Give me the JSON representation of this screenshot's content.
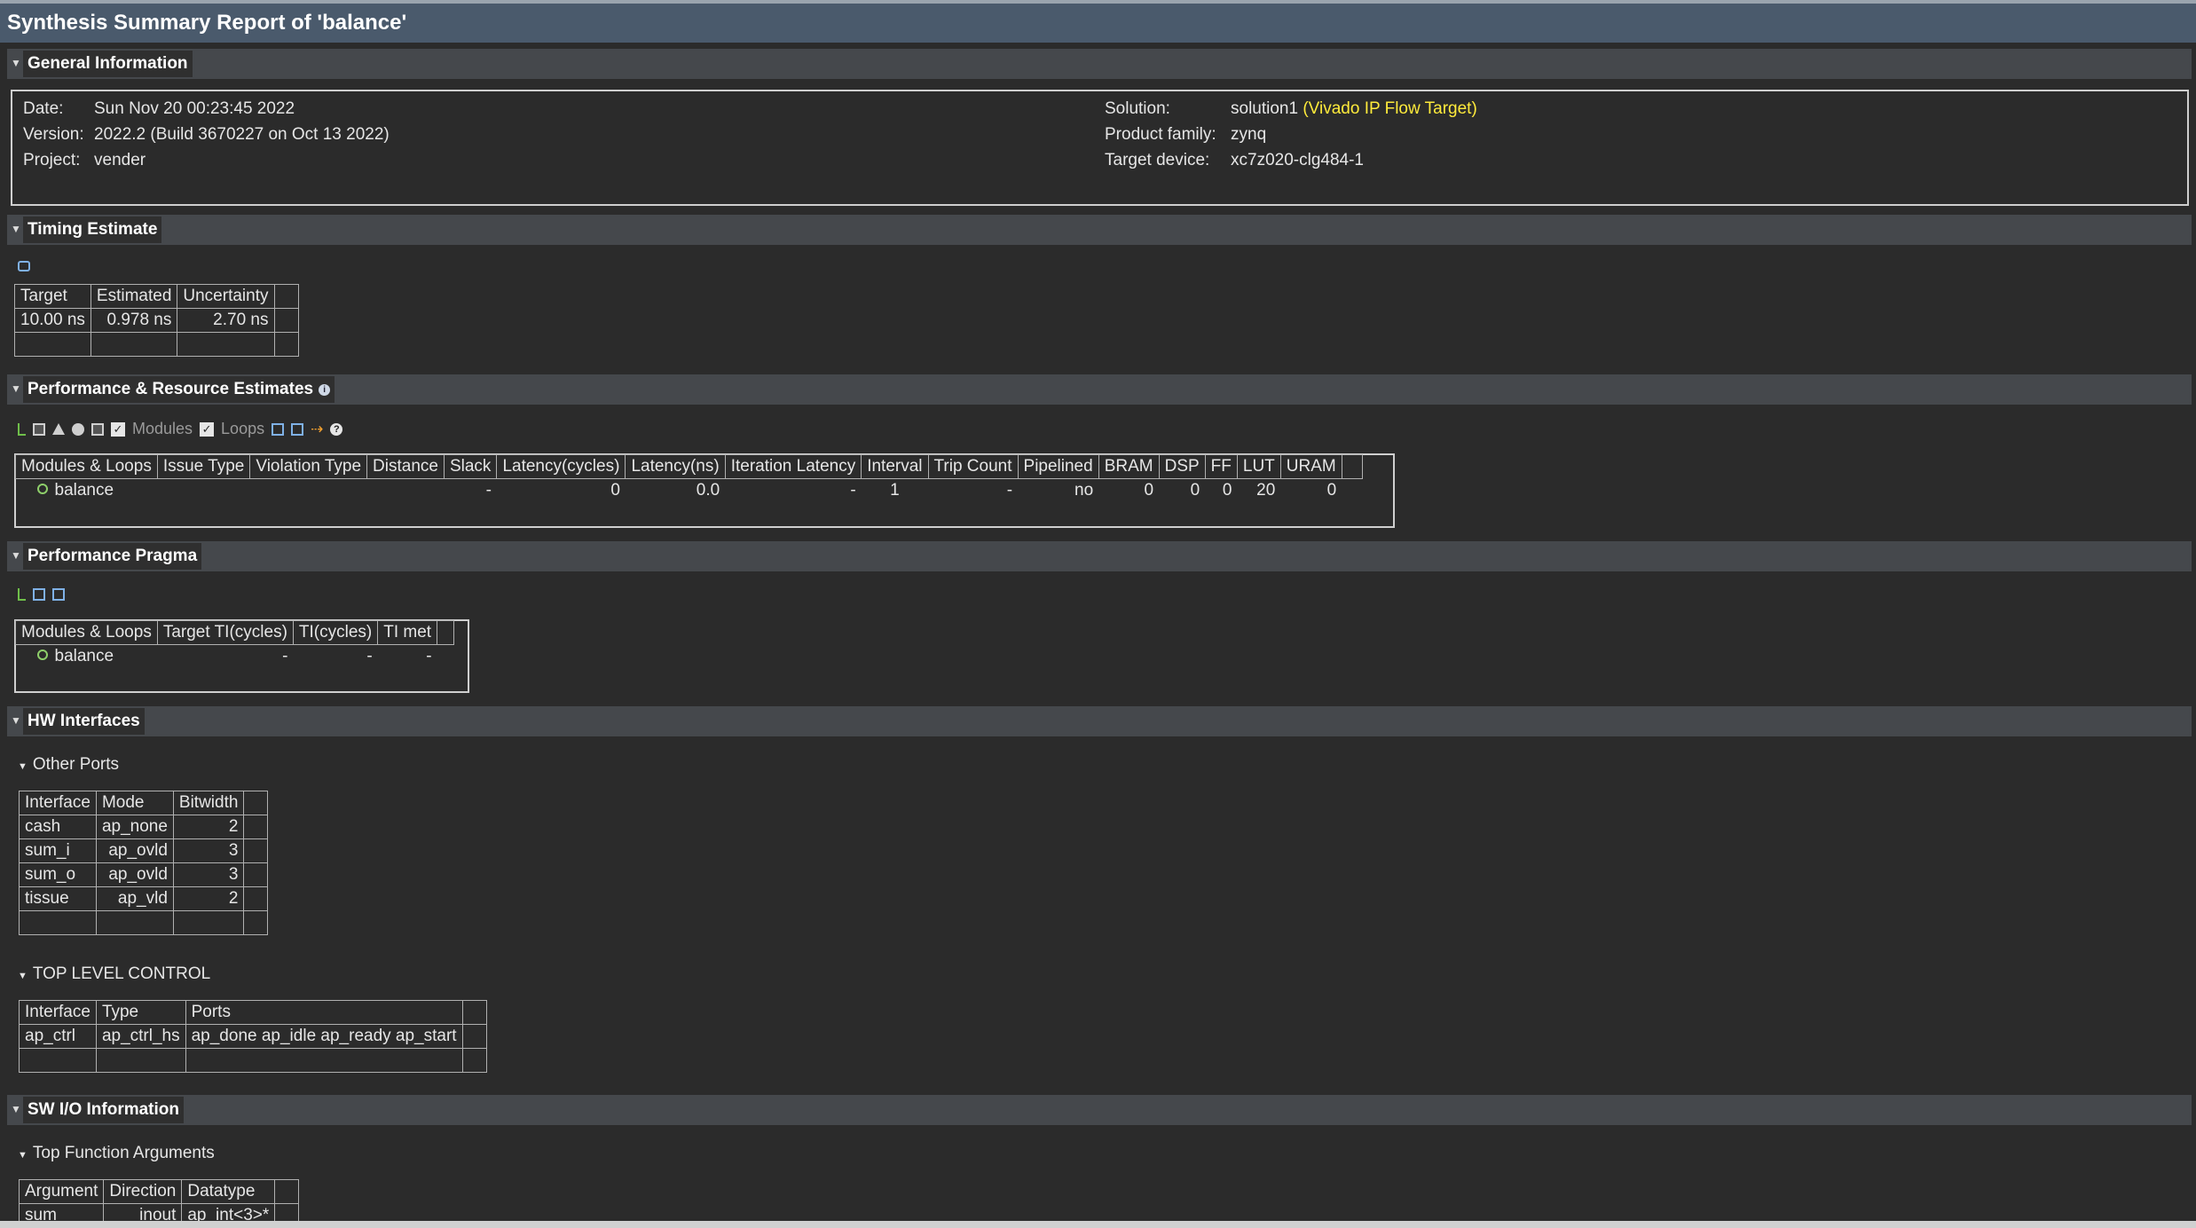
{
  "report_title": "Synthesis Summary Report of 'balance'",
  "general": {
    "header": "General Information",
    "date_label": "Date:",
    "date": "Sun Nov 20 00:23:45 2022",
    "version_label": "Version:",
    "version": "2022.2 (Build 3670227 on Oct 13 2022)",
    "project_label": "Project:",
    "project": "vender",
    "solution_label": "Solution:",
    "solution": "solution1",
    "solution_flow": "(Vivado IP Flow Target)",
    "family_label": "Product family:",
    "family": "zynq",
    "device_label": "Target device:",
    "device": "xc7z020-clg484-1"
  },
  "timing": {
    "header": "Timing Estimate",
    "columns": [
      "Target",
      "Estimated",
      "Uncertainty"
    ],
    "row": [
      "10.00 ns",
      "0.978 ns",
      "2.70 ns"
    ]
  },
  "perf": {
    "header": "Performance & Resource Estimates",
    "modules_label": "Modules",
    "loops_label": "Loops",
    "columns": [
      "Modules & Loops",
      "Issue Type",
      "Violation Type",
      "Distance",
      "Slack",
      "Latency(cycles)",
      "Latency(ns)",
      "Iteration Latency",
      "Interval",
      "Trip Count",
      "Pipelined",
      "BRAM",
      "DSP",
      "FF",
      "LUT",
      "URAM"
    ],
    "row": [
      "balance",
      "",
      "",
      "",
      "-",
      "0",
      "0.0",
      "-",
      "1",
      "-",
      "no",
      "0",
      "0",
      "0",
      "20",
      "0"
    ]
  },
  "pragma": {
    "header": "Performance Pragma",
    "columns": [
      "Modules & Loops",
      "Target TI(cycles)",
      "TI(cycles)",
      "TI met"
    ],
    "row": [
      "balance",
      "-",
      "-",
      "-"
    ]
  },
  "hw": {
    "header": "HW Interfaces",
    "other_ports_label": "Other Ports",
    "ports_columns": [
      "Interface",
      "Mode",
      "Bitwidth"
    ],
    "ports": [
      [
        "cash",
        "ap_none",
        "2"
      ],
      [
        "sum_i",
        "ap_ovld",
        "3"
      ],
      [
        "sum_o",
        "ap_ovld",
        "3"
      ],
      [
        "tissue",
        "ap_vld",
        "2"
      ]
    ],
    "control_label": "TOP LEVEL CONTROL",
    "control_columns": [
      "Interface",
      "Type",
      "Ports"
    ],
    "control_row": [
      "ap_ctrl",
      "ap_ctrl_hs",
      "ap_done ap_idle ap_ready ap_start"
    ]
  },
  "sw": {
    "header": "SW I/O Information",
    "args_label": "Top Function Arguments",
    "args_columns": [
      "Argument",
      "Direction",
      "Datatype"
    ],
    "args_row": [
      "sum",
      "inout",
      "ap_int<3>*"
    ]
  },
  "colors": {
    "title_bar": "#4a5a6c",
    "section_header": "#45484c",
    "highlight": "#ffeb3b",
    "background": "#2b2b2b"
  }
}
